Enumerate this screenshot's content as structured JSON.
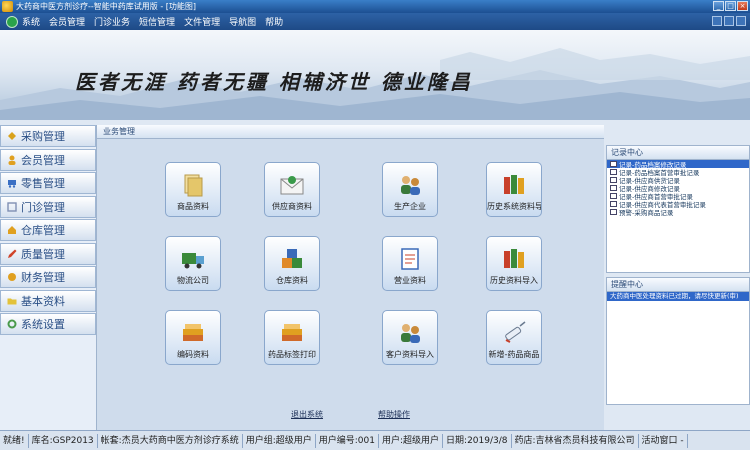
{
  "window": {
    "title": "大药商中医方剂诊疗--智能中药库试用版 - [功能图]",
    "controls": [
      "minimize",
      "maximize",
      "close"
    ]
  },
  "menu": {
    "items": [
      "系统",
      "会员管理",
      "门诊业务",
      "短信管理",
      "文件管理",
      "导航图",
      "帮助"
    ]
  },
  "banner": {
    "slogan": "医者无涯  药者无疆  相辅济世  德业隆昌"
  },
  "sidebar": {
    "items": [
      {
        "label": "采购管理",
        "icon": "arrow-icon",
        "color": "#d9a21b"
      },
      {
        "label": "会员管理",
        "icon": "member-icon",
        "color": "#e0a020"
      },
      {
        "label": "零售管理",
        "icon": "cart-icon",
        "color": "#3a6fc4"
      },
      {
        "label": "门诊管理",
        "icon": "clinic-icon",
        "color": "#7f8fb3"
      },
      {
        "label": "仓库管理",
        "icon": "warehouse-icon",
        "color": "#e0a020"
      },
      {
        "label": "质量管理",
        "icon": "pencil-icon",
        "color": "#d0442a"
      },
      {
        "label": "财务管理",
        "icon": "finance-icon",
        "color": "#e0a020"
      },
      {
        "label": "基本资料",
        "icon": "folder-icon",
        "color": "#e3c23a"
      },
      {
        "label": "系统设置",
        "icon": "settings-icon",
        "color": "#4a9a4a"
      }
    ]
  },
  "business": {
    "header": "业务管理",
    "tiles": [
      {
        "label": "商品资料",
        "icon": "documents-icon",
        "color": "#e4c66a"
      },
      {
        "label": "供应商资料",
        "icon": "envelope-icon",
        "color": "#3a9a4a"
      },
      {
        "label": "生产企业",
        "icon": "people-icon",
        "color": "#c98a3a"
      },
      {
        "label": "历史系统资料导入",
        "icon": "books-icon",
        "color": "#c8402a"
      },
      {
        "label": "物流公司",
        "icon": "truck-icon",
        "color": "#3a8a3a"
      },
      {
        "label": "仓库资料",
        "icon": "boxes-icon",
        "color": "#e08a2a"
      },
      {
        "label": "营业资料",
        "icon": "clipboard-icon",
        "color": "#3a6ab8"
      },
      {
        "label": "历史资料导入",
        "icon": "books-icon",
        "color": "#c8402a"
      },
      {
        "label": "编码资料",
        "icon": "stack-icon",
        "color": "#d06a2a"
      },
      {
        "label": "药品标签打印",
        "icon": "stack-icon",
        "color": "#d06a2a"
      },
      {
        "label": "客户资料导入",
        "icon": "people-icon",
        "color": "#c98a3a"
      },
      {
        "label": "新增-药品商品",
        "icon": "syringe-icon",
        "color": "#9aa6b8"
      }
    ],
    "links": [
      "退出系统",
      "帮助操作"
    ]
  },
  "records": {
    "header": "记录中心",
    "items": [
      "记录-药品档案修改记录",
      "记录-药品档案首营审批记录",
      "记录-供应商供货记录",
      "记录-供应商修改记录",
      "记录-供应商首营审批记录",
      "记录-供应商代表首营审批记录",
      "预警-采购商品记录"
    ],
    "selected_index": 0
  },
  "notice": {
    "header": "提醒中心",
    "items": [
      "大药商中医处理资料已过期，请尽快更新(审)"
    ]
  },
  "status": {
    "cells": [
      "就绪!",
      "库名:GSP2013",
      "帐套:杰员大药商中医方剂诊疗系统",
      "用户组:超级用户",
      "用户编号:001",
      "用户:超级用户",
      "日期:2019/3/8",
      "药店:吉林省杰员科技有限公司",
      "活动窗口 -"
    ]
  }
}
